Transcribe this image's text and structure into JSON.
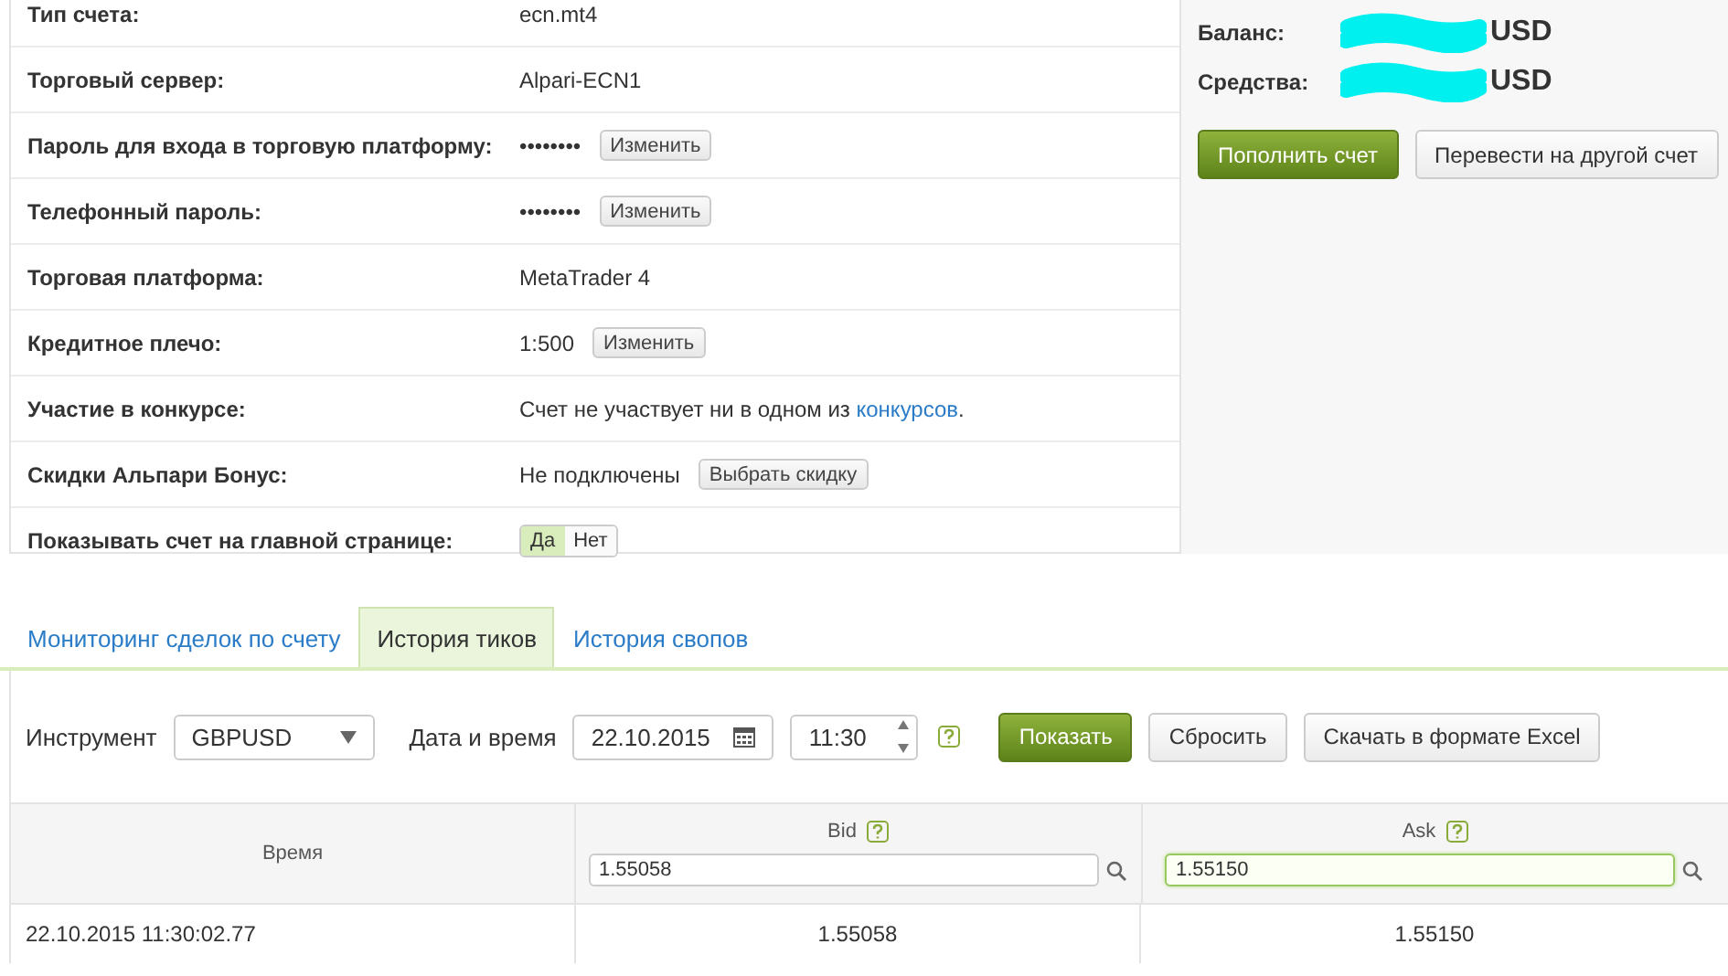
{
  "account_rows": [
    {
      "label": "Тип счета:",
      "kind": "text",
      "value": "ecn.mt4"
    },
    {
      "label": "Торговый сервер:",
      "kind": "text",
      "value": "Alpari-ECN1"
    },
    {
      "label": "Пароль для входа в торговую платформу:",
      "kind": "action",
      "value": "••••••••",
      "button": "Изменить"
    },
    {
      "label": "Телефонный пароль:",
      "kind": "action",
      "value": "••••••••",
      "button": "Изменить"
    },
    {
      "label": "Торговая платформа:",
      "kind": "text",
      "value": "MetaTrader 4"
    },
    {
      "label": "Кредитное плечо:",
      "kind": "action",
      "value": "1:500",
      "button": "Изменить"
    },
    {
      "label": "Участие в конкурсе:",
      "kind": "link",
      "value": "Счет не участвует ни в одном из",
      "link": "конкурсов",
      "after": "."
    },
    {
      "label": "Скидки Альпари Бонус:",
      "kind": "action",
      "value": "Не подключены",
      "button": "Выбрать скидку"
    },
    {
      "label": "Показывать счет на главной странице:",
      "kind": "toggle",
      "options": [
        {
          "label": "Да",
          "selected": true
        },
        {
          "label": "Нет",
          "selected": false
        }
      ]
    }
  ],
  "summary": {
    "items": [
      {
        "label": "Баланс:",
        "currency": "USD"
      },
      {
        "label": "Средства:",
        "currency": "USD"
      }
    ],
    "buttons": [
      {
        "label": "Пополнить счет",
        "primary": true
      },
      {
        "label": "Перевести на другой счет",
        "primary": false
      }
    ]
  },
  "tabs": [
    {
      "label": "Мониторинг сделок по счету",
      "selected": false
    },
    {
      "label": "История тиков",
      "selected": true
    },
    {
      "label": "История свопов",
      "selected": false
    }
  ],
  "filters": {
    "instrument_label": "Инструмент",
    "instrument": "GBPUSD",
    "datetime_label": "Дата и время",
    "date": "22.10.2015",
    "time": "11:30",
    "show": "Показать",
    "reset": "Сбросить",
    "excel": "Скачать в формате Excel"
  },
  "table": {
    "columns": [
      {
        "title": "Время"
      },
      {
        "title": "Bid",
        "filter": "1.55058",
        "focused": false
      },
      {
        "title": "Ask",
        "filter": "1.55150",
        "focused": true
      }
    ],
    "rows": [
      [
        "22.10.2015 11:30:02.77",
        "1.55058",
        "1.55150"
      ]
    ]
  }
}
